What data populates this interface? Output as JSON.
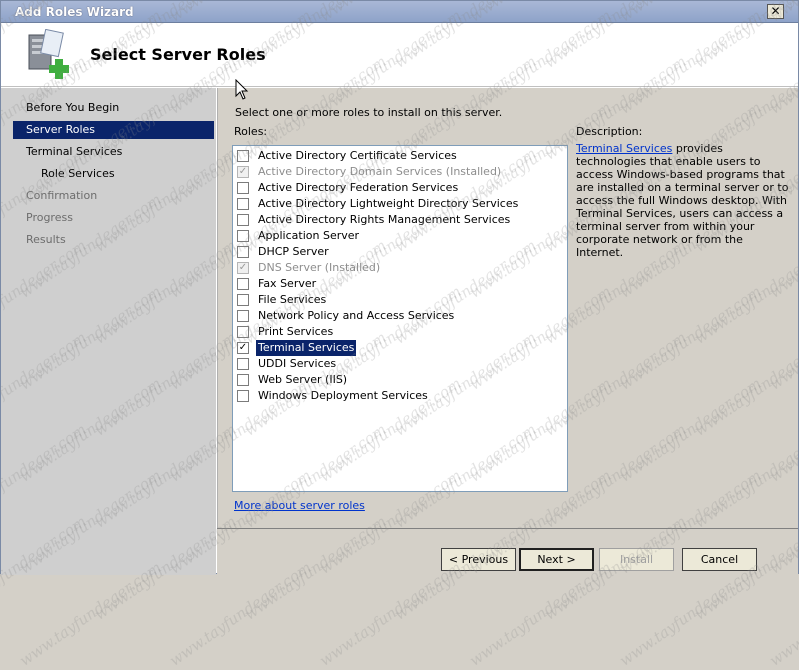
{
  "window": {
    "title": "Add Roles Wizard"
  },
  "header": {
    "page_title": "Select Server Roles"
  },
  "nav": {
    "items": [
      {
        "label": "Before You Begin",
        "state": "normal"
      },
      {
        "label": "Server Roles",
        "state": "selected"
      },
      {
        "label": "Terminal Services",
        "state": "normal"
      },
      {
        "label": "Role Services",
        "state": "normal"
      },
      {
        "label": "Confirmation",
        "state": "disabled"
      },
      {
        "label": "Progress",
        "state": "disabled"
      },
      {
        "label": "Results",
        "state": "disabled"
      }
    ]
  },
  "content": {
    "instruction": "Select one or more roles to install on this server.",
    "roles_label": "Roles:",
    "roles": [
      {
        "label": "Active Directory Certificate Services",
        "checked": false,
        "installed": false
      },
      {
        "label": "Active Directory Domain Services  (Installed)",
        "checked": true,
        "installed": true
      },
      {
        "label": "Active Directory Federation Services",
        "checked": false,
        "installed": false
      },
      {
        "label": "Active Directory Lightweight Directory Services",
        "checked": false,
        "installed": false
      },
      {
        "label": "Active Directory Rights Management Services",
        "checked": false,
        "installed": false
      },
      {
        "label": "Application Server",
        "checked": false,
        "installed": false
      },
      {
        "label": "DHCP Server",
        "checked": false,
        "installed": false
      },
      {
        "label": "DNS Server  (Installed)",
        "checked": true,
        "installed": true
      },
      {
        "label": "Fax Server",
        "checked": false,
        "installed": false
      },
      {
        "label": "File Services",
        "checked": false,
        "installed": false
      },
      {
        "label": "Network Policy and Access Services",
        "checked": false,
        "installed": false
      },
      {
        "label": "Print Services",
        "checked": false,
        "installed": false
      },
      {
        "label": "Terminal Services",
        "checked": true,
        "installed": false,
        "selected": true
      },
      {
        "label": "UDDI Services",
        "checked": false,
        "installed": false
      },
      {
        "label": "Web Server (IIS)",
        "checked": false,
        "installed": false
      },
      {
        "label": "Windows Deployment Services",
        "checked": false,
        "installed": false
      }
    ],
    "description_label": "Description:",
    "description_link": "Terminal Services",
    "description_text": " provides technologies that enable users to access Windows-based programs that are installed on a terminal server or to access the full Windows desktop. With Terminal Services, users can access a terminal server from within your corporate network or from the Internet.",
    "more_link": "More about server roles"
  },
  "buttons": {
    "previous": "< Previous",
    "next": "Next >",
    "install": "Install",
    "cancel": "Cancel"
  },
  "watermark": "www.tayfundeger.com",
  "colors": {
    "selection": "#0a246a",
    "link": "#0033cc"
  }
}
